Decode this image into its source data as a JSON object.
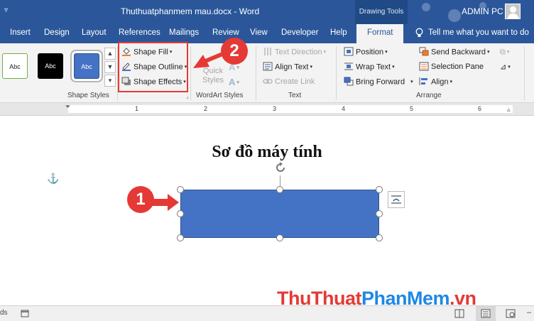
{
  "titlebar": {
    "qa_label": "▿",
    "title": "Thuthuatphanmem mau.docx  -  Word",
    "contextual_group": "Drawing Tools",
    "user": "ADMIN PC"
  },
  "tabs": {
    "insert": "Insert",
    "design": "Design",
    "layout": "Layout",
    "references": "References",
    "mailings": "Mailings",
    "review": "Review",
    "view": "View",
    "developer": "Developer",
    "help": "Help",
    "format": "Format"
  },
  "tellme": "Tell me what you want to do",
  "ribbon": {
    "shape_styles": {
      "label": "Shape Styles",
      "thumbs": [
        "Abc",
        "Abc",
        "Abc"
      ]
    },
    "shape_fill": "Shape Fill",
    "shape_outline": "Shape Outline",
    "shape_effects": "Shape Effects",
    "quick_styles_line1": "Quick",
    "quick_styles_line2": "Styles",
    "wordart_label": "WordArt Styles",
    "text_direction": "Text Direction",
    "align_text": "Align Text",
    "create_link": "Create Link",
    "text_label": "Text",
    "position": "Position",
    "wrap_text": "Wrap Text",
    "bring_forward": "Bring Forward",
    "send_backward": "Send Backward",
    "selection_pane": "Selection Pane",
    "align": "Align",
    "arrange_label": "Arrange"
  },
  "ruler": {
    "numbers": [
      "1",
      "2",
      "3",
      "4",
      "5",
      "6"
    ]
  },
  "document": {
    "heading": "Sơ đồ máy tính"
  },
  "statusbar": {
    "left_text": "ds"
  },
  "callouts": {
    "one": "1",
    "two": "2"
  },
  "watermark": {
    "part1": "ThuThuat",
    "part2": "PhanMem",
    "part3": ".vn"
  },
  "colors": {
    "word_blue": "#2b579a",
    "shape_fill": "#4472c4",
    "callout_red": "#e53935"
  }
}
